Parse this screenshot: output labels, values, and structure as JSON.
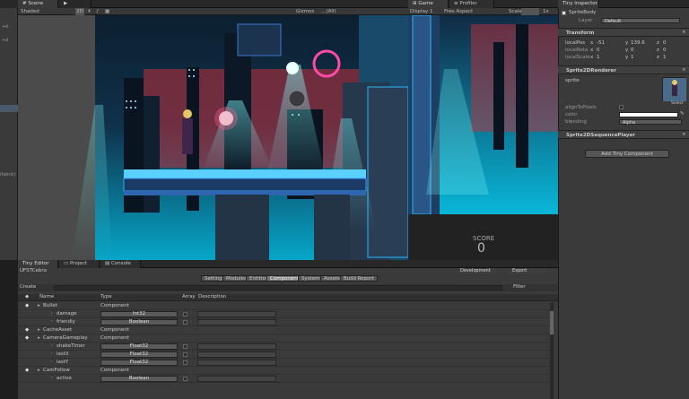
{
  "left_strip": {
    "labels": [
      "+é",
      "+é",
      "ifabric)"
    ]
  },
  "scene": {
    "tab": "Scene",
    "shading": "Shaded",
    "mode_2d": "2D",
    "gizmos": "Gizmos",
    "search": "…(All)"
  },
  "game": {
    "tab": "Game",
    "profiler_tab": "Profiler",
    "display": "Display 1",
    "aspect": "Free Aspect",
    "scale_label": "Scale",
    "scale_value": "1x",
    "score_label": "SCORE",
    "score_value": "0"
  },
  "inspector": {
    "tab": "Tiny Inspector",
    "entity_name": "SpriteBody",
    "layer_label": "Layer",
    "layer_value": "Default",
    "transform": {
      "title": "Transform",
      "localPos": {
        "label": "localPos",
        "x": "-51",
        "y": "139.6",
        "z": "0"
      },
      "localRota": {
        "label": "localRota",
        "x": "0",
        "y": "0",
        "z": "0"
      },
      "localScale": {
        "label": "localScale",
        "x": "1",
        "y": "1",
        "z": "1"
      }
    },
    "sprite_renderer": {
      "title": "Sprite2DRenderer",
      "sprite_label": "sprite",
      "select_label": "Select",
      "alignToPixels_label": "alignToPixels",
      "color_label": "color",
      "blending_label": "blending",
      "blending_value": "Alpha"
    },
    "sequence_player_title": "Sprite2DSequencePlayer",
    "add_component": "Add Tiny Component"
  },
  "bottom": {
    "tabs": [
      "Tiny Editor",
      "Project",
      "Console"
    ],
    "project_name": "UFSTCebra",
    "config": "Development",
    "export": "Export",
    "subtabs": [
      "Settings",
      "Modules",
      "Entities",
      "Components",
      "Systems",
      "Assets",
      "Build Report"
    ],
    "active_subtab": "Components",
    "create": "Create",
    "filter": "Filter",
    "columns": [
      "Name",
      "Type",
      "Array",
      "Description"
    ],
    "rows": [
      {
        "name": "Bullet",
        "type": "Component",
        "kind": "component"
      },
      {
        "name": "damage",
        "type": "Int32",
        "kind": "field"
      },
      {
        "name": "friendly",
        "type": "Boolean",
        "kind": "field"
      },
      {
        "name": "CacheAsset",
        "type": "Component",
        "kind": "component"
      },
      {
        "name": "CameraGameplay",
        "type": "Component",
        "kind": "component"
      },
      {
        "name": "shakeTimer",
        "type": "Float32",
        "kind": "field"
      },
      {
        "name": "lastX",
        "type": "Float32",
        "kind": "field"
      },
      {
        "name": "lastY",
        "type": "Float32",
        "kind": "field"
      },
      {
        "name": "CamFollow",
        "type": "Component",
        "kind": "component"
      },
      {
        "name": "active",
        "type": "Boolean",
        "kind": "field"
      }
    ]
  }
}
